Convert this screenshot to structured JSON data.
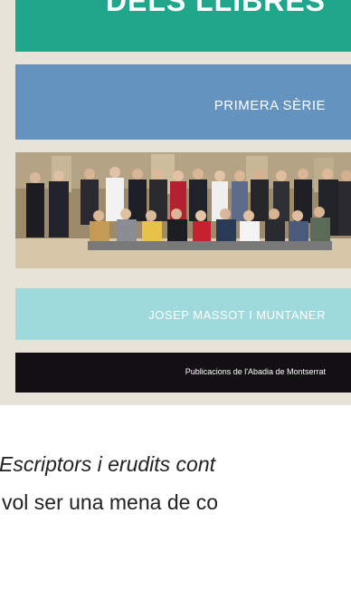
{
  "cover": {
    "title": "DELS LLIBRES",
    "series": "PRIMERA SÈRIE",
    "author": "JOSEP MASSOT I MUNTANER",
    "publisher": "Publicacions de l'Abadia de Montserrat",
    "colors": {
      "title_band": "#1fa68b",
      "series_band": "#6393be",
      "author_band": "#9ed9dc",
      "publisher_band": "#121012",
      "background": "#e7e3d8"
    }
  },
  "caption": {
    "line1": "Escriptors i erudits cont",
    "line2": "vol ser una mena de co"
  }
}
